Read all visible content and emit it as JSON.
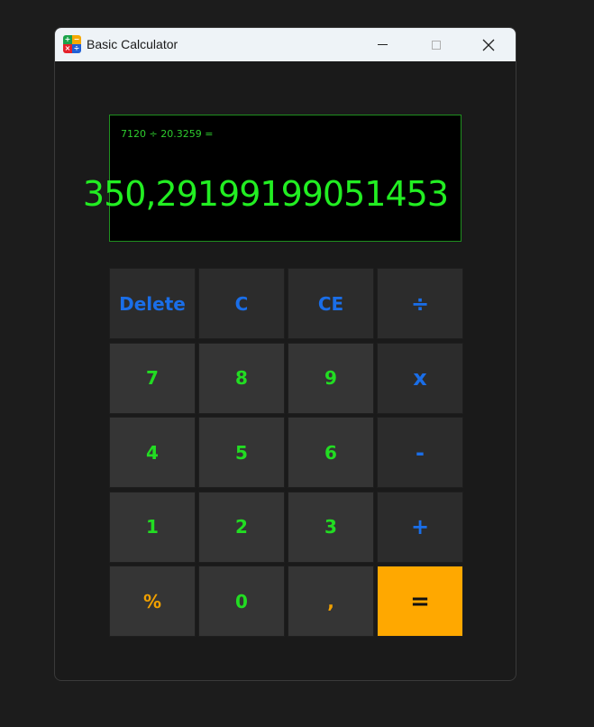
{
  "window": {
    "title": "Basic Calculator",
    "icon_name": "calculator-app-icon",
    "icon_glyphs": [
      "+",
      "−",
      "×",
      "÷"
    ],
    "controls": {
      "minimize": "minimize-icon",
      "maximize": "maximize-icon",
      "close": "close-icon"
    },
    "close_glyph": "✕"
  },
  "display": {
    "expression": "7120 ÷ 20.3259 =",
    "result": "350,29199199051453"
  },
  "keypad": {
    "rows": [
      [
        {
          "label": "Delete",
          "name": "delete-button",
          "style": "top"
        },
        {
          "label": "C",
          "name": "clear-button",
          "style": "top"
        },
        {
          "label": "CE",
          "name": "clear-entry-button",
          "style": "top"
        },
        {
          "label": "÷",
          "name": "divide-button",
          "style": "op"
        }
      ],
      [
        {
          "label": "7",
          "name": "digit-7-button",
          "style": "num"
        },
        {
          "label": "8",
          "name": "digit-8-button",
          "style": "num"
        },
        {
          "label": "9",
          "name": "digit-9-button",
          "style": "num"
        },
        {
          "label": "x",
          "name": "multiply-button",
          "style": "op"
        }
      ],
      [
        {
          "label": "4",
          "name": "digit-4-button",
          "style": "num"
        },
        {
          "label": "5",
          "name": "digit-5-button",
          "style": "num"
        },
        {
          "label": "6",
          "name": "digit-6-button",
          "style": "num"
        },
        {
          "label": "-",
          "name": "subtract-button",
          "style": "op"
        }
      ],
      [
        {
          "label": "1",
          "name": "digit-1-button",
          "style": "num"
        },
        {
          "label": "2",
          "name": "digit-2-button",
          "style": "num"
        },
        {
          "label": "3",
          "name": "digit-3-button",
          "style": "num"
        },
        {
          "label": "+",
          "name": "add-button",
          "style": "op"
        }
      ],
      [
        {
          "label": "%",
          "name": "percent-button",
          "style": "alt"
        },
        {
          "label": "0",
          "name": "digit-0-button",
          "style": "num"
        },
        {
          "label": ",",
          "name": "decimal-comma-button",
          "style": "alt"
        },
        {
          "label": "=",
          "name": "equals-button",
          "style": "eq"
        }
      ]
    ]
  },
  "colors": {
    "display_text": "#22ee22",
    "operator_text": "#1a6ee8",
    "digit_text": "#22dd22",
    "accent_orange": "#ffa800"
  }
}
